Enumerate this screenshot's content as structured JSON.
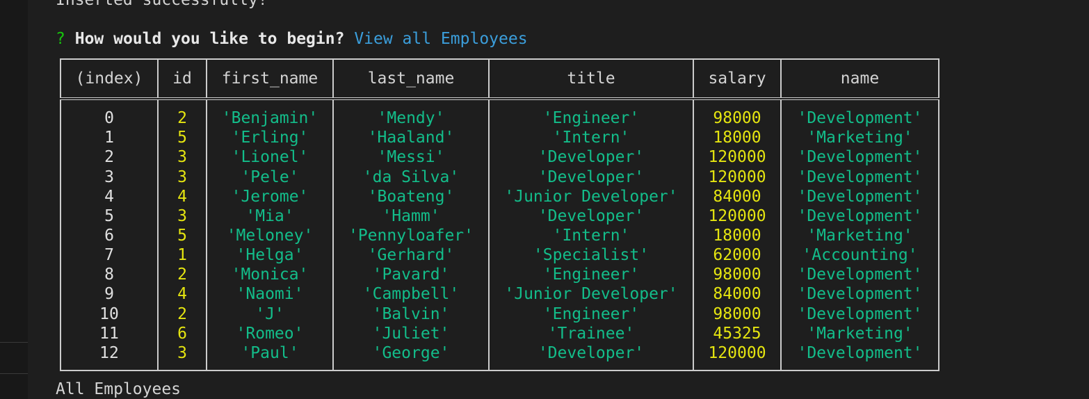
{
  "terminal": {
    "previous_output": "Inserted successfully!",
    "prompt_mark": "?",
    "prompt_question": "How would you like to begin?",
    "prompt_answer": "View all Employees",
    "footer_text": "All Employees"
  },
  "table": {
    "headers": [
      "(index)",
      "id",
      "first_name",
      "last_name",
      "title",
      "salary",
      "name"
    ],
    "rows": [
      {
        "index": "0",
        "id": "2",
        "first_name": "'Benjamin'",
        "last_name": "'Mendy'",
        "title": "'Engineer'",
        "salary": "98000",
        "name": "'Development'"
      },
      {
        "index": "1",
        "id": "5",
        "first_name": "'Erling'",
        "last_name": "'Haaland'",
        "title": "'Intern'",
        "salary": "18000",
        "name": "'Marketing'"
      },
      {
        "index": "2",
        "id": "3",
        "first_name": "'Lionel'",
        "last_name": "'Messi'",
        "title": "'Developer'",
        "salary": "120000",
        "name": "'Development'"
      },
      {
        "index": "3",
        "id": "3",
        "first_name": "'Pele'",
        "last_name": "'da Silva'",
        "title": "'Developer'",
        "salary": "120000",
        "name": "'Development'"
      },
      {
        "index": "4",
        "id": "4",
        "first_name": "'Jerome'",
        "last_name": "'Boateng'",
        "title": "'Junior Developer'",
        "salary": "84000",
        "name": "'Development'"
      },
      {
        "index": "5",
        "id": "3",
        "first_name": "'Mia'",
        "last_name": "'Hamm'",
        "title": "'Developer'",
        "salary": "120000",
        "name": "'Development'"
      },
      {
        "index": "6",
        "id": "5",
        "first_name": "'Meloney'",
        "last_name": "'Pennyloafer'",
        "title": "'Intern'",
        "salary": "18000",
        "name": "'Marketing'"
      },
      {
        "index": "7",
        "id": "1",
        "first_name": "'Helga'",
        "last_name": "'Gerhard'",
        "title": "'Specialist'",
        "salary": "62000",
        "name": "'Accounting'"
      },
      {
        "index": "8",
        "id": "2",
        "first_name": "'Monica'",
        "last_name": "'Pavard'",
        "title": "'Engineer'",
        "salary": "98000",
        "name": "'Development'"
      },
      {
        "index": "9",
        "id": "4",
        "first_name": "'Naomi'",
        "last_name": "'Campbell'",
        "title": "'Junior Developer'",
        "salary": "84000",
        "name": "'Development'"
      },
      {
        "index": "10",
        "id": "2",
        "first_name": "'J'",
        "last_name": "'Balvin'",
        "title": "'Engineer'",
        "salary": "98000",
        "name": "'Development'"
      },
      {
        "index": "11",
        "id": "6",
        "first_name": "'Romeo'",
        "last_name": "'Juliet'",
        "title": "'Trainee'",
        "salary": "45325",
        "name": "'Marketing'"
      },
      {
        "index": "12",
        "id": "3",
        "first_name": "'Paul'",
        "last_name": "'George'",
        "title": "'Developer'",
        "salary": "120000",
        "name": "'Development'"
      }
    ]
  },
  "colors": {
    "background": "#1e1e1e",
    "number": "#e5e510",
    "string": "#13bd8a",
    "prompt_mark": "#16c60c",
    "answer": "#3b9edb",
    "border": "#cccccc"
  }
}
